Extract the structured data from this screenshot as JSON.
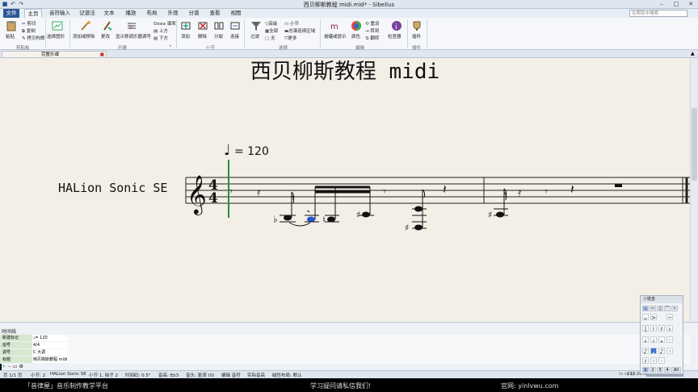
{
  "window": {
    "title": "西贝柳斯教程 midi.mid* - Sibelius",
    "search_placeholder": "在帮助中搜索"
  },
  "menu": {
    "tabs": [
      "文件",
      "主页",
      "音符输入",
      "记谱法",
      "文本",
      "播放",
      "布局",
      "外观",
      "分谱",
      "查看",
      "视图"
    ],
    "active": "主页"
  },
  "ribbon": {
    "clipboard": {
      "paste": "粘贴",
      "cut": "剪切",
      "copy": "复制",
      "format_painter": "拷贝构想",
      "group": "剪贴板"
    },
    "select_graphic": "选择图形",
    "instruments": {
      "add_remove": "添加或移除",
      "change": "更改",
      "show_transposing": "显示移调乐器调号",
      "ossia_staff": "Ossia 谱表",
      "above": "上方",
      "below": "下方",
      "group": "乐器"
    },
    "bars": {
      "add": "添加",
      "delete": "删除",
      "split": "分裂",
      "join": "连接",
      "group": "小节"
    },
    "selection": {
      "filter": "过滤",
      "all": "全部",
      "none": "无",
      "advanced": "高级",
      "bar": "小节",
      "system_passage": "总谱连续区域",
      "more": "更多",
      "group": "选择"
    },
    "edit": {
      "reset_note_spacing": "拔罐或提示",
      "color": "颜色",
      "reset": "重设",
      "transpose": "转到",
      "flip": "翻转",
      "inspector": "检查器",
      "group": "编辑"
    },
    "plugins": {
      "label": "插件",
      "group": "插件"
    }
  },
  "document_tab": "完整乐谱",
  "score": {
    "title": "西贝柳斯教程 midi",
    "instrument": "HALion Sonic SE",
    "tempo_value": "= 120",
    "time_signature": "4/4"
  },
  "timeline": {
    "header": "时间线",
    "rows": [
      {
        "name": "新建标记",
        "value": "♩= 120"
      },
      {
        "name": "拍号",
        "value": "4/4"
      },
      {
        "name": "调号",
        "value": "C 大调"
      },
      {
        "name": "标题",
        "value": "西贝柳斯教程 midi"
      }
    ]
  },
  "status": {
    "page": "页 1/1 页",
    "bars": "小节: 2",
    "instrument": "HALion Sonic SE",
    "position": "小节 1, 拍子 2",
    "timecode": "时间码: 0.5\"",
    "pitch": "音高: Eb3",
    "chord": "音头: 复调 (0)",
    "edit_mode": "编辑 音符",
    "concert": "实际音高",
    "layout": "磁性布局: 默认",
    "zoom": "212.00%"
  },
  "keypad": {
    "title": "小键盘",
    "rows": [
      [
        "𝄪",
        "𝅗𝅥",
        "♩",
        "♪",
        "𝅘𝅥𝅯"
      ],
      [
        "|",
        "♮",
        "♯",
        "♭"
      ],
      [
        "𝅘𝅥",
        "𝅗𝅥",
        "𝅝",
        "·"
      ],
      [
        "♪",
        "♩",
        "♪",
        "𝄾"
      ],
      [
        "𝄽",
        "𝄾",
        "·"
      ]
    ],
    "layouts": [
      "1",
      "2",
      "3",
      "4",
      "All"
    ]
  },
  "footer": {
    "left": "「音律屋」音乐制作教学平台",
    "center": "学习疑问请私信我们!",
    "right": "官网: yinlvwu.com"
  }
}
